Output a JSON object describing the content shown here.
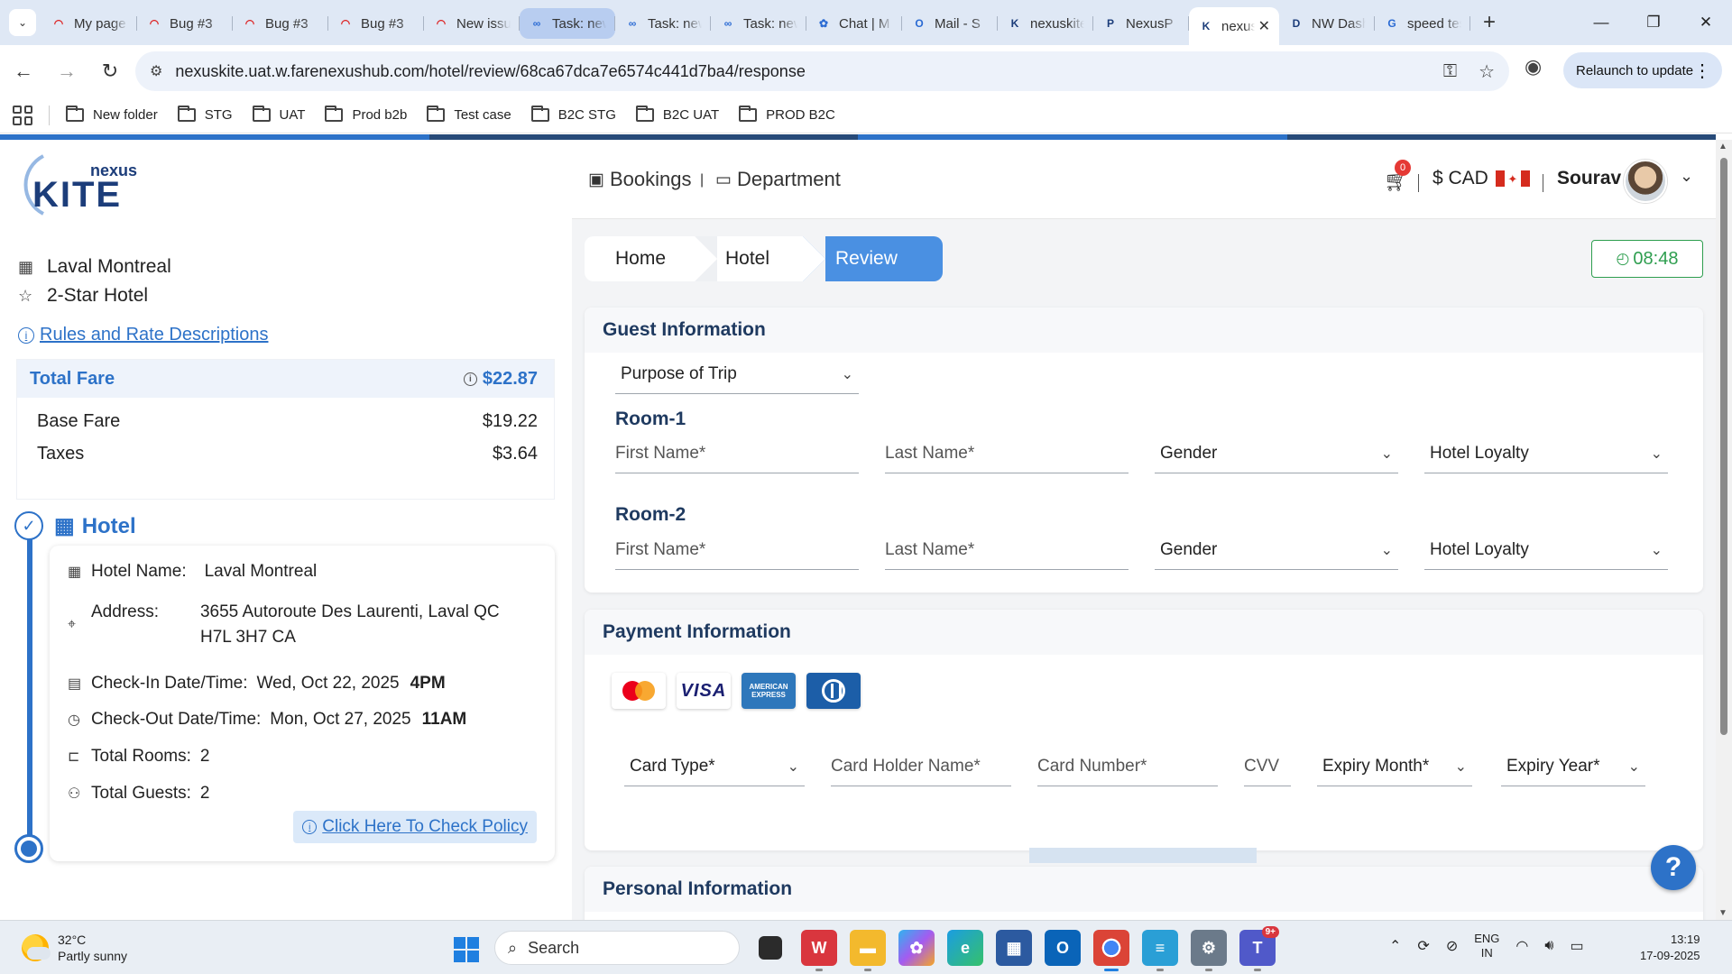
{
  "browser": {
    "tabs": [
      {
        "title": "My page",
        "icon": "red",
        "state": "normal"
      },
      {
        "title": "Bug #3",
        "icon": "red",
        "state": "normal"
      },
      {
        "title": "Bug #3",
        "icon": "red",
        "state": "normal"
      },
      {
        "title": "Bug #3",
        "icon": "red",
        "state": "normal"
      },
      {
        "title": "New issue",
        "icon": "red",
        "state": "normal"
      },
      {
        "title": "Task: new",
        "icon": "blue",
        "state": "highlight"
      },
      {
        "title": "Task: new",
        "icon": "blue",
        "state": "normal"
      },
      {
        "title": "Task: new",
        "icon": "blue",
        "state": "normal"
      },
      {
        "title": "Chat | M",
        "icon": "copilot",
        "state": "normal"
      },
      {
        "title": "Mail - S",
        "icon": "outlook",
        "state": "normal"
      },
      {
        "title": "nexuskite",
        "icon": "k",
        "state": "normal"
      },
      {
        "title": "NexusP",
        "icon": "p",
        "state": "normal"
      },
      {
        "title": "nexuskite",
        "icon": "k",
        "state": "active"
      },
      {
        "title": "NW Dash",
        "icon": "d",
        "state": "normal"
      },
      {
        "title": "speed test",
        "icon": "g",
        "state": "normal"
      }
    ],
    "url": "nexuskite.uat.w.farenexushub.com/hotel/review/68ca67dca7e6574c441d7ba4/response",
    "relaunch_label": "Relaunch to update",
    "bookmarks": [
      "New folder",
      "STG",
      "UAT",
      "Prod b2b",
      "Test case",
      "B2C STG",
      "B2C UAT",
      "PROD B2C"
    ]
  },
  "left": {
    "logo_top": "nexus",
    "logo_main": "KITE",
    "hotel_name": "Laval Montreal",
    "star_rating": "2-Star Hotel",
    "rules_link": "Rules and Rate Descriptions",
    "fare": {
      "total_label": "Total Fare",
      "total_value": "$22.87",
      "base_label": "Base Fare",
      "base_value": "$19.22",
      "taxes_label": "Taxes",
      "taxes_value": "$3.64"
    },
    "hotel_section_title": "Hotel",
    "details": {
      "name_label": "Hotel Name:",
      "name_value": "Laval Montreal",
      "address_label": "Address:",
      "address_line1": "3655 Autoroute Des Laurenti, Laval QC",
      "address_line2": "H7L 3H7 CA",
      "checkin_label": "Check-In Date/Time:",
      "checkin_date": "Wed, Oct 22, 2025",
      "checkin_time": "4PM",
      "checkout_label": "Check-Out Date/Time:",
      "checkout_date": "Mon, Oct 27, 2025",
      "checkout_time": "11AM",
      "rooms_label": "Total Rooms:",
      "rooms_value": "2",
      "guests_label": "Total Guests:",
      "guests_value": "2",
      "policy_link": "Click Here To Check Policy"
    }
  },
  "topnav": {
    "bookings": "Bookings",
    "pipe": "|",
    "department": "Department",
    "cart_count": "0",
    "currency": "$ CAD",
    "user": "Sourav"
  },
  "breadcrumbs": [
    "Home",
    "Hotel",
    "Review"
  ],
  "timer": "08:48",
  "guest_info": {
    "title": "Guest Information",
    "purpose_placeholder": "Purpose of Trip",
    "rooms": [
      {
        "title": "Room-1",
        "first": "First Name*",
        "last": "Last Name*",
        "gender": "Gender",
        "loyalty": "Hotel Loyalty"
      },
      {
        "title": "Room-2",
        "first": "First Name*",
        "last": "Last Name*",
        "gender": "Gender",
        "loyalty": "Hotel Loyalty"
      }
    ]
  },
  "payment": {
    "title": "Payment Information",
    "card_brands": [
      "mastercard",
      "VISA",
      "AMERICAN EXPRESS",
      "diners-club"
    ],
    "card_type": "Card Type*",
    "holder": "Card Holder Name*",
    "number": "Card Number*",
    "cvv": "CVV",
    "exp_month": "Expiry Month*",
    "exp_year": "Expiry Year*"
  },
  "personal_info": {
    "title": "Personal Information"
  },
  "help_label": "?",
  "taskbar": {
    "temperature": "32°C",
    "weather": "Partly sunny",
    "search": "Search",
    "lang1": "ENG",
    "lang2": "IN",
    "time": "13:19",
    "date": "17-09-2025",
    "teams_badge": "9+"
  },
  "colors": {
    "accent": "#2d72c8",
    "timer_green": "#2e9e4f",
    "heading_navy": "#1f3a60"
  }
}
